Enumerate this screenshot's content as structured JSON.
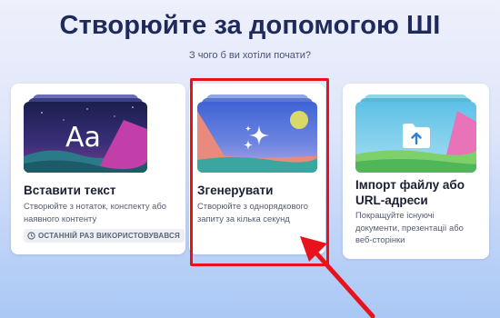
{
  "header": {
    "title": "Створюйте за допомогою ШІ",
    "subtitle": "З чого б ви хотіли почати?"
  },
  "cards": [
    {
      "title": "Вставити текст",
      "description_lines": [
        "Створюйте з нотаток, конспекту або",
        "наявного контенту"
      ],
      "badge": "ОСТАННІЙ РАЗ ВИКОРИСТОВУВАВСЯ",
      "thumb_text": "Aa",
      "thumb_icon": "text-aa-icon"
    },
    {
      "title": "Згенерувати",
      "description_lines": [
        "Створюйте з однорядкового",
        "запиту за кілька секунд"
      ],
      "thumb_icon": "sparkles-icon"
    },
    {
      "title_lines": [
        "Імпорт файлу або",
        "URL-адреси"
      ],
      "description_lines": [
        "Покращуйте існуючі",
        "документи, презентації або",
        "веб-сторінки"
      ],
      "thumb_icon": "folder-upload-icon"
    }
  ],
  "colors": {
    "title": "#1f2a5c",
    "highlight": "#e8121b",
    "card_bg": "#ffffff"
  }
}
